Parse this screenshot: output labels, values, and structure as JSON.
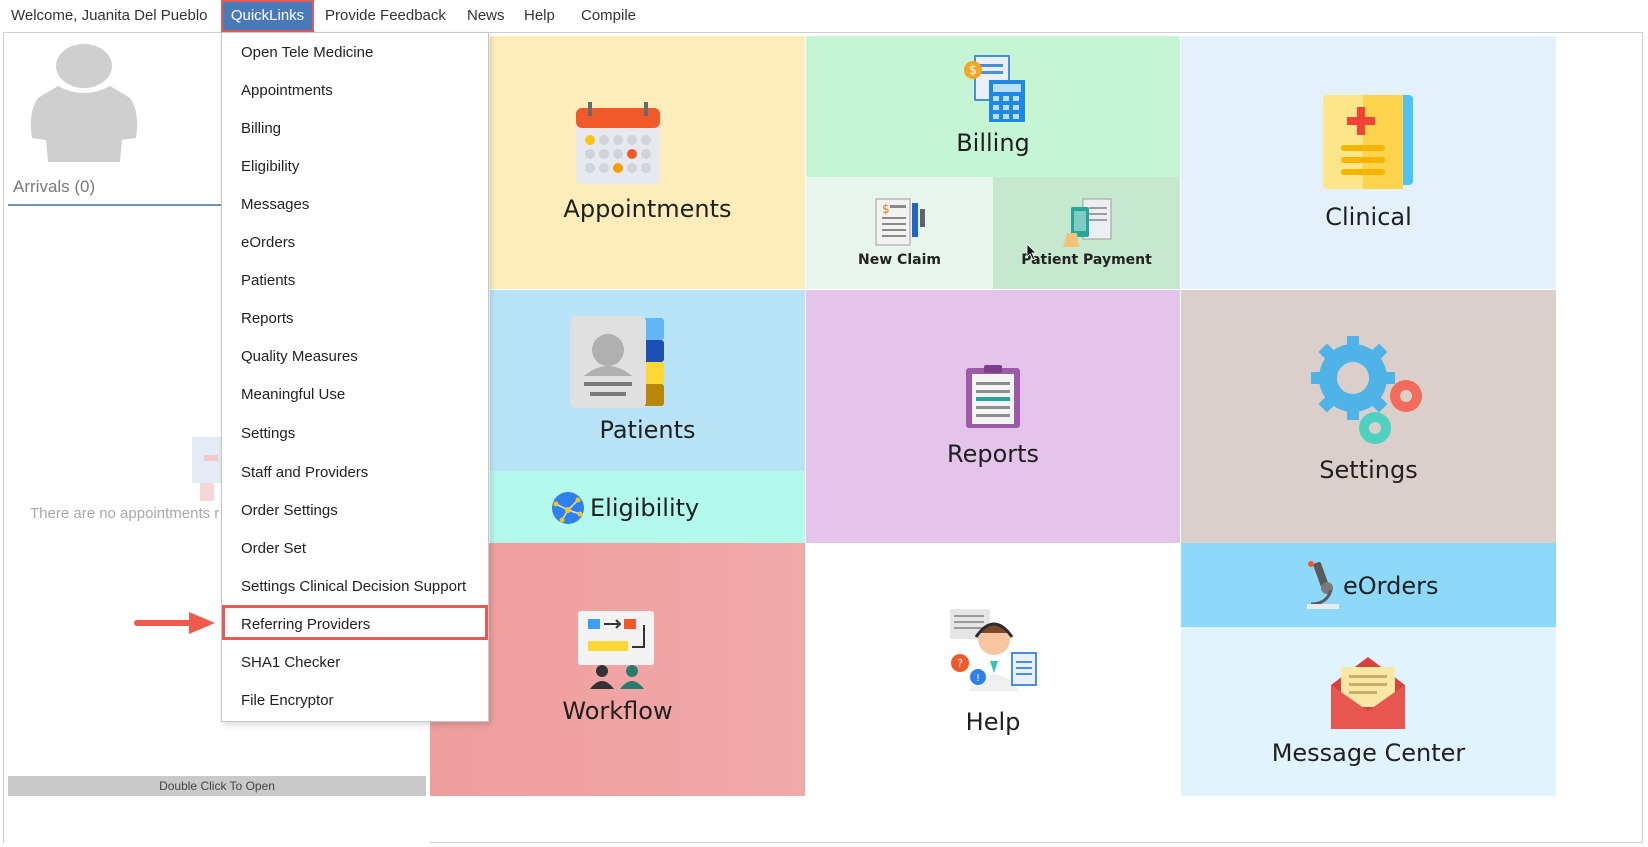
{
  "menubar": {
    "welcome": "Welcome, Juanita Del Pueblo",
    "quicklinks": "QuickLinks",
    "feedback": "Provide Feedback",
    "news": "News",
    "help": "Help",
    "compile": "Compile"
  },
  "left_panel": {
    "arrivals": "Arrivals (0)",
    "empty_message": "There are no appointments r",
    "double_click": "Double Click To Open"
  },
  "quicklinks_menu": {
    "items": [
      "Open Tele Medicine",
      "Appointments",
      "Billing",
      "Eligibility",
      "Messages",
      "eOrders",
      "Patients",
      "Reports",
      "Quality Measures",
      "Meaningful Use",
      "Settings",
      "Staff and Providers",
      "Order Settings",
      "Order Set",
      "Settings Clinical Decision Support",
      "Referring Providers",
      "SHA1 Checker",
      "File Encryptor"
    ],
    "highlighted": "Referring Providers"
  },
  "tiles": {
    "appointments": "Appointments",
    "billing": "Billing",
    "new_claim": "New Claim",
    "patient_payment": "Patient Payment",
    "clinical": "Clinical",
    "patients": "Patients",
    "eligibility": "Eligibility",
    "reports": "Reports",
    "settings": "Settings",
    "workflow": "Workflow",
    "help": "Help",
    "eorders": "eOrders",
    "message_center": "Message Center"
  },
  "colors": {
    "quicklinks_active": "#4a79b9",
    "highlight_border": "#e25b54",
    "appointments_bg": "#fcedba",
    "billing_bg": "#c6f5d5",
    "clinical_bg": "#e4f1fb",
    "patients_bg": "#b9e4f8",
    "eligibility_bg": "#b3f9ec",
    "reports_bg": "#e4c4ea",
    "settings_bg": "#dbcfcb",
    "workflow_bg": "#efa1a1",
    "eorders_bg": "#8ed9fa",
    "message_center_bg": "#e1f3fd"
  },
  "icons": [
    "person-avatar-icon",
    "calendar-icon",
    "billing-calculator-icon",
    "claim-document-icon",
    "payment-phone-icon",
    "clinical-file-icon",
    "contact-book-icon",
    "globe-network-icon",
    "clipboard-report-icon",
    "gears-icon",
    "workflow-board-icon",
    "help-agent-icon",
    "microscope-icon",
    "envelope-icon",
    "mouse-cursor-icon"
  ]
}
